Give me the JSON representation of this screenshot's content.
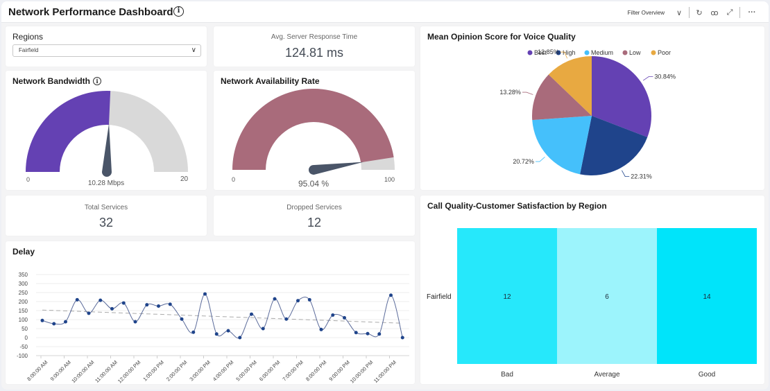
{
  "header": {
    "title": "Network Performance Dashboard",
    "info_icon": "i",
    "filter_label": "Filter Overview",
    "icons": [
      "chevron-down-icon",
      "refresh-icon",
      "glasses-icon",
      "expand-icon",
      "more-icon"
    ],
    "chevron": "∨",
    "refresh": "↻",
    "glasses": "ꝏ",
    "expand": "⤢",
    "more": "···"
  },
  "regions": {
    "title": "Regions",
    "selected": "Fairfield",
    "chevron": "∨"
  },
  "response_time": {
    "label": "Avg. Server Response Time",
    "value": "124.81 ms"
  },
  "bandwidth": {
    "title": "Network Bandwidth",
    "info_icon": "i",
    "min_label": "0",
    "max_label": "20",
    "value_label": "10.28 Mbps",
    "value": 10.28,
    "min": 0,
    "max": 20,
    "fill_color": "#6441b3",
    "track_color": "#d9d9d9"
  },
  "availability": {
    "title": "Network Availability Rate",
    "min_label": "0",
    "max_label": "100",
    "value_label": "95.04 %",
    "value": 95.04,
    "min": 0,
    "max": 100,
    "fill_color": "#a96b7b",
    "track_color": "#d9d9d9"
  },
  "total_services": {
    "label": "Total Services",
    "value": "32"
  },
  "dropped_services": {
    "label": "Dropped Services",
    "value": "12"
  },
  "chart_data": [
    {
      "type": "pie",
      "title": "Mean Opinion Score for Voice Quality",
      "legend_position": "top",
      "slices": [
        {
          "name": "Best",
          "value": 30.84,
          "label": "30.84%",
          "color": "#6441b3"
        },
        {
          "name": "High",
          "value": 22.31,
          "label": "22.31%",
          "color": "#1f448b"
        },
        {
          "name": "Medium",
          "value": 20.72,
          "label": "20.72%",
          "color": "#45c0fb"
        },
        {
          "name": "Low",
          "value": 13.28,
          "label": "13.28%",
          "color": "#a96b7b"
        },
        {
          "name": "Poor",
          "value": 12.85,
          "label": "12.85%",
          "color": "#e8a941"
        }
      ]
    },
    {
      "type": "line",
      "title": "Delay",
      "xlabel": "",
      "ylabel": "",
      "ylim": [
        -100,
        350
      ],
      "yticks": [
        350,
        300,
        250,
        200,
        150,
        100,
        50,
        0,
        -50,
        -100
      ],
      "xtick_labels": [
        "8:00:00 AM",
        "9:00:00 AM",
        "10:00:00 AM",
        "11:00:00 AM",
        "12:00:00 PM",
        "1:00:00 PM",
        "2:00:00 PM",
        "3:00:00 PM",
        "4:00:00 PM",
        "5:00:00 PM",
        "6:00:00 PM",
        "7:00:00 PM",
        "8:00:00 PM",
        "9:00:00 PM",
        "10:00:00 PM",
        "11:00:00 PM"
      ],
      "grid": true,
      "series": [
        {
          "name": "Delay",
          "color": "#1f448b",
          "values": [
            95,
            77,
            88,
            210,
            135,
            207,
            160,
            192,
            88,
            182,
            175,
            185,
            103,
            30,
            242,
            20,
            38,
            0,
            130,
            50,
            215,
            103,
            205,
            210,
            45,
            125,
            110,
            28,
            22,
            20,
            235,
            0
          ]
        }
      ],
      "trendline": {
        "start": 153,
        "end": 80,
        "color": "#aaaaaa",
        "style": "dashed"
      }
    },
    {
      "type": "heatmap",
      "title": "Call Quality-Customer Satisfaction by Region",
      "rows": [
        "Fairfield"
      ],
      "columns": [
        "Bad",
        "Average",
        "Good"
      ],
      "values": [
        [
          12,
          6,
          14
        ]
      ],
      "colors": [
        "#26e8fb",
        "#9cf4fc",
        "#00e4fa"
      ]
    }
  ]
}
